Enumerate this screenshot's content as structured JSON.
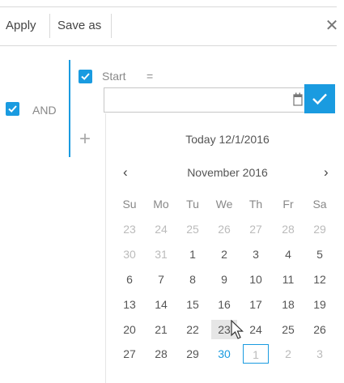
{
  "toolbar": {
    "apply_label": "Apply",
    "save_as_label": "Save as",
    "close_glyph": "✕"
  },
  "filter": {
    "group_operator": "AND",
    "condition": {
      "field": "Start",
      "operator": "=",
      "value": ""
    },
    "add_glyph": "+"
  },
  "calendar": {
    "today_label": "Today 12/1/2016",
    "month_label": "November 2016",
    "prev_glyph": "‹",
    "next_glyph": "›",
    "weekdays": [
      "Su",
      "Mo",
      "Tu",
      "We",
      "Th",
      "Fr",
      "Sa"
    ],
    "weeks": [
      [
        "23",
        "24",
        "25",
        "26",
        "27",
        "28",
        "29"
      ],
      [
        "30",
        "31",
        "1",
        "2",
        "3",
        "4",
        "5"
      ],
      [
        "6",
        "7",
        "8",
        "9",
        "10",
        "11",
        "12"
      ],
      [
        "13",
        "14",
        "15",
        "16",
        "17",
        "18",
        "19"
      ],
      [
        "20",
        "21",
        "22",
        "23",
        "24",
        "25",
        "26"
      ],
      [
        "27",
        "28",
        "29",
        "30",
        "1",
        "2",
        "3"
      ]
    ],
    "today_day": "30",
    "hovered_day": "23",
    "selected_day": "1"
  },
  "colors": {
    "accent": "#1a9be0",
    "separator": "#d9d9d9",
    "muted_text": "#888888"
  }
}
